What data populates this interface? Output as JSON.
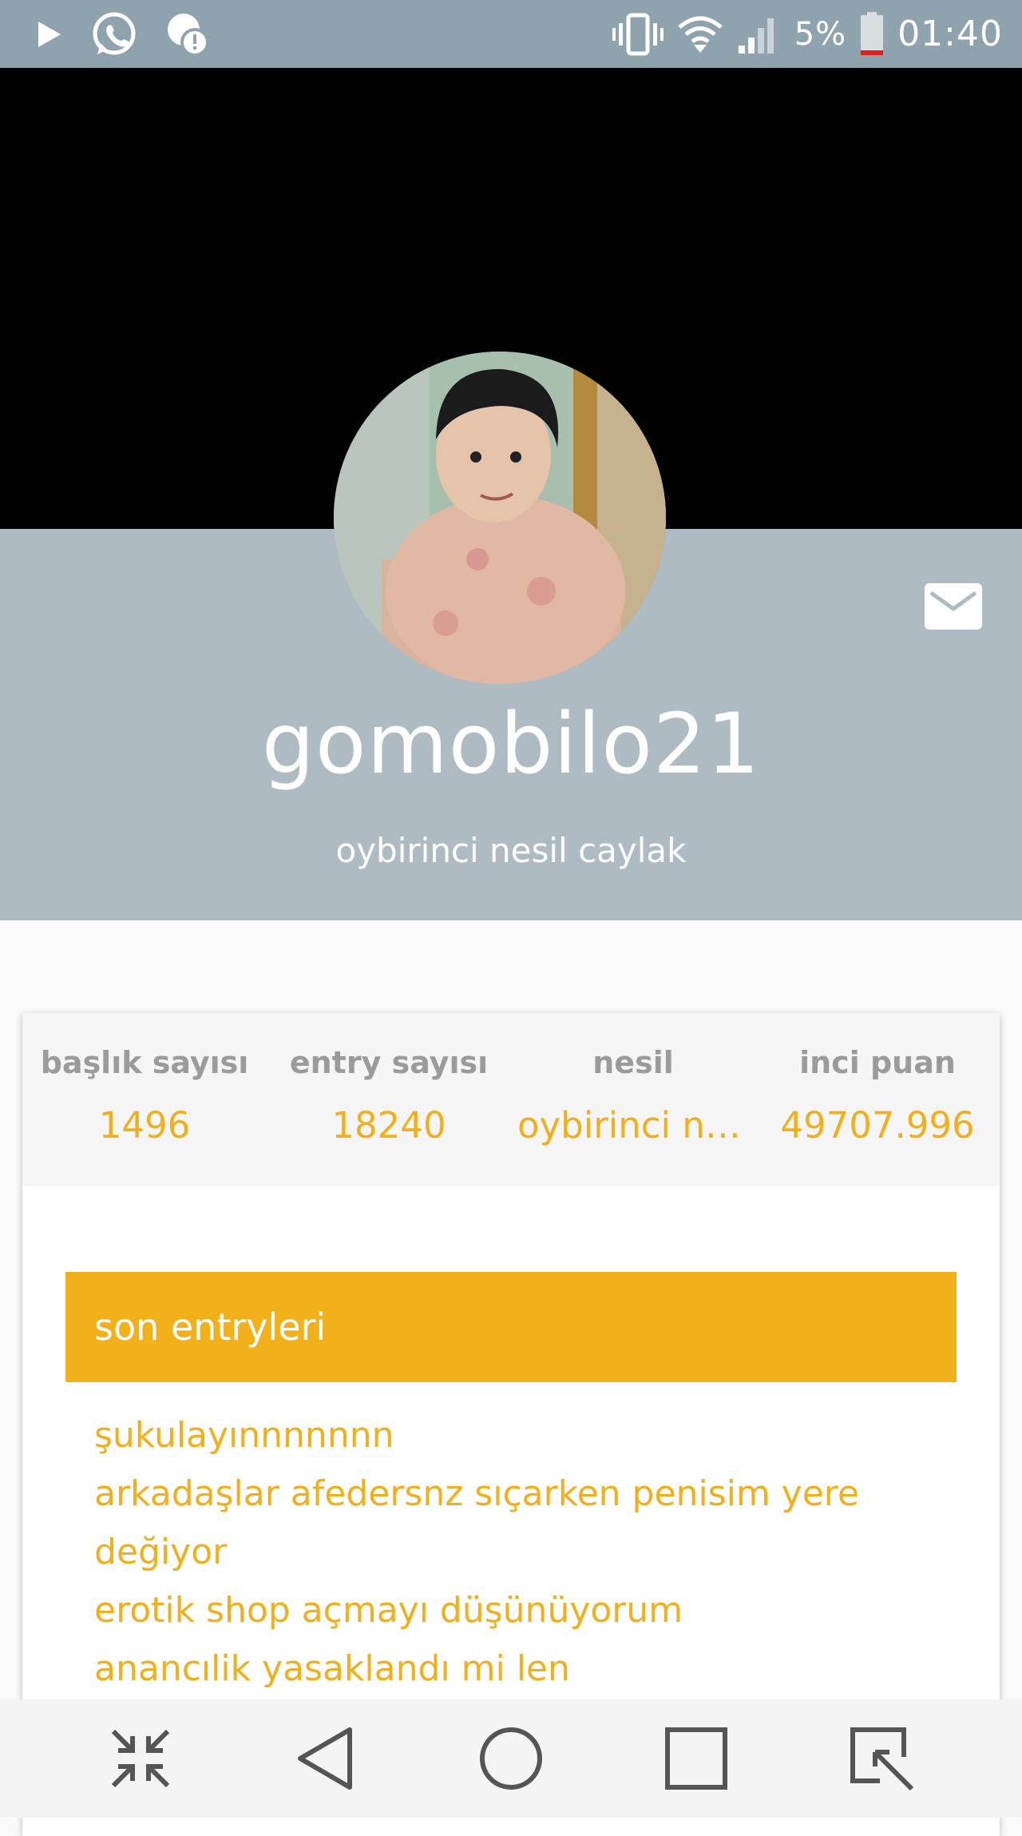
{
  "status_bar": {
    "battery_percent": "5%",
    "time": "01:40",
    "icons": [
      "play-icon",
      "whatsapp-icon",
      "notification-alert-icon",
      "vibrate-icon",
      "wifi-icon",
      "signal-icon",
      "battery-icon"
    ]
  },
  "profile": {
    "username": "gomobilo21",
    "generation": "oybirinci nesil caylak"
  },
  "stats": [
    {
      "label": "başlık sayısı",
      "value": "1496"
    },
    {
      "label": "entry sayısı",
      "value": "18240"
    },
    {
      "label": "nesil",
      "value": "oybirinci nesi…"
    },
    {
      "label": "inci puan",
      "value": "49707.996"
    }
  ],
  "recent_entries": {
    "title": "son entryleri",
    "items": [
      "şukulayınnnnnnn",
      "arkadaşlar afedersnz sıçarken penisim yere değiyor",
      "erotik shop açmayı düşünüyorum",
      "anancılik yasaklandı mi len"
    ]
  },
  "nav_bar": {
    "buttons": [
      "collapse-icon",
      "back-icon",
      "home-icon",
      "recents-icon",
      "edit-icon"
    ]
  },
  "colors": {
    "status_bar": "#8ea3ae",
    "header_bg": "#aebbc3",
    "accent": "#f2b11b",
    "stat_label": "#9b9b9b"
  }
}
